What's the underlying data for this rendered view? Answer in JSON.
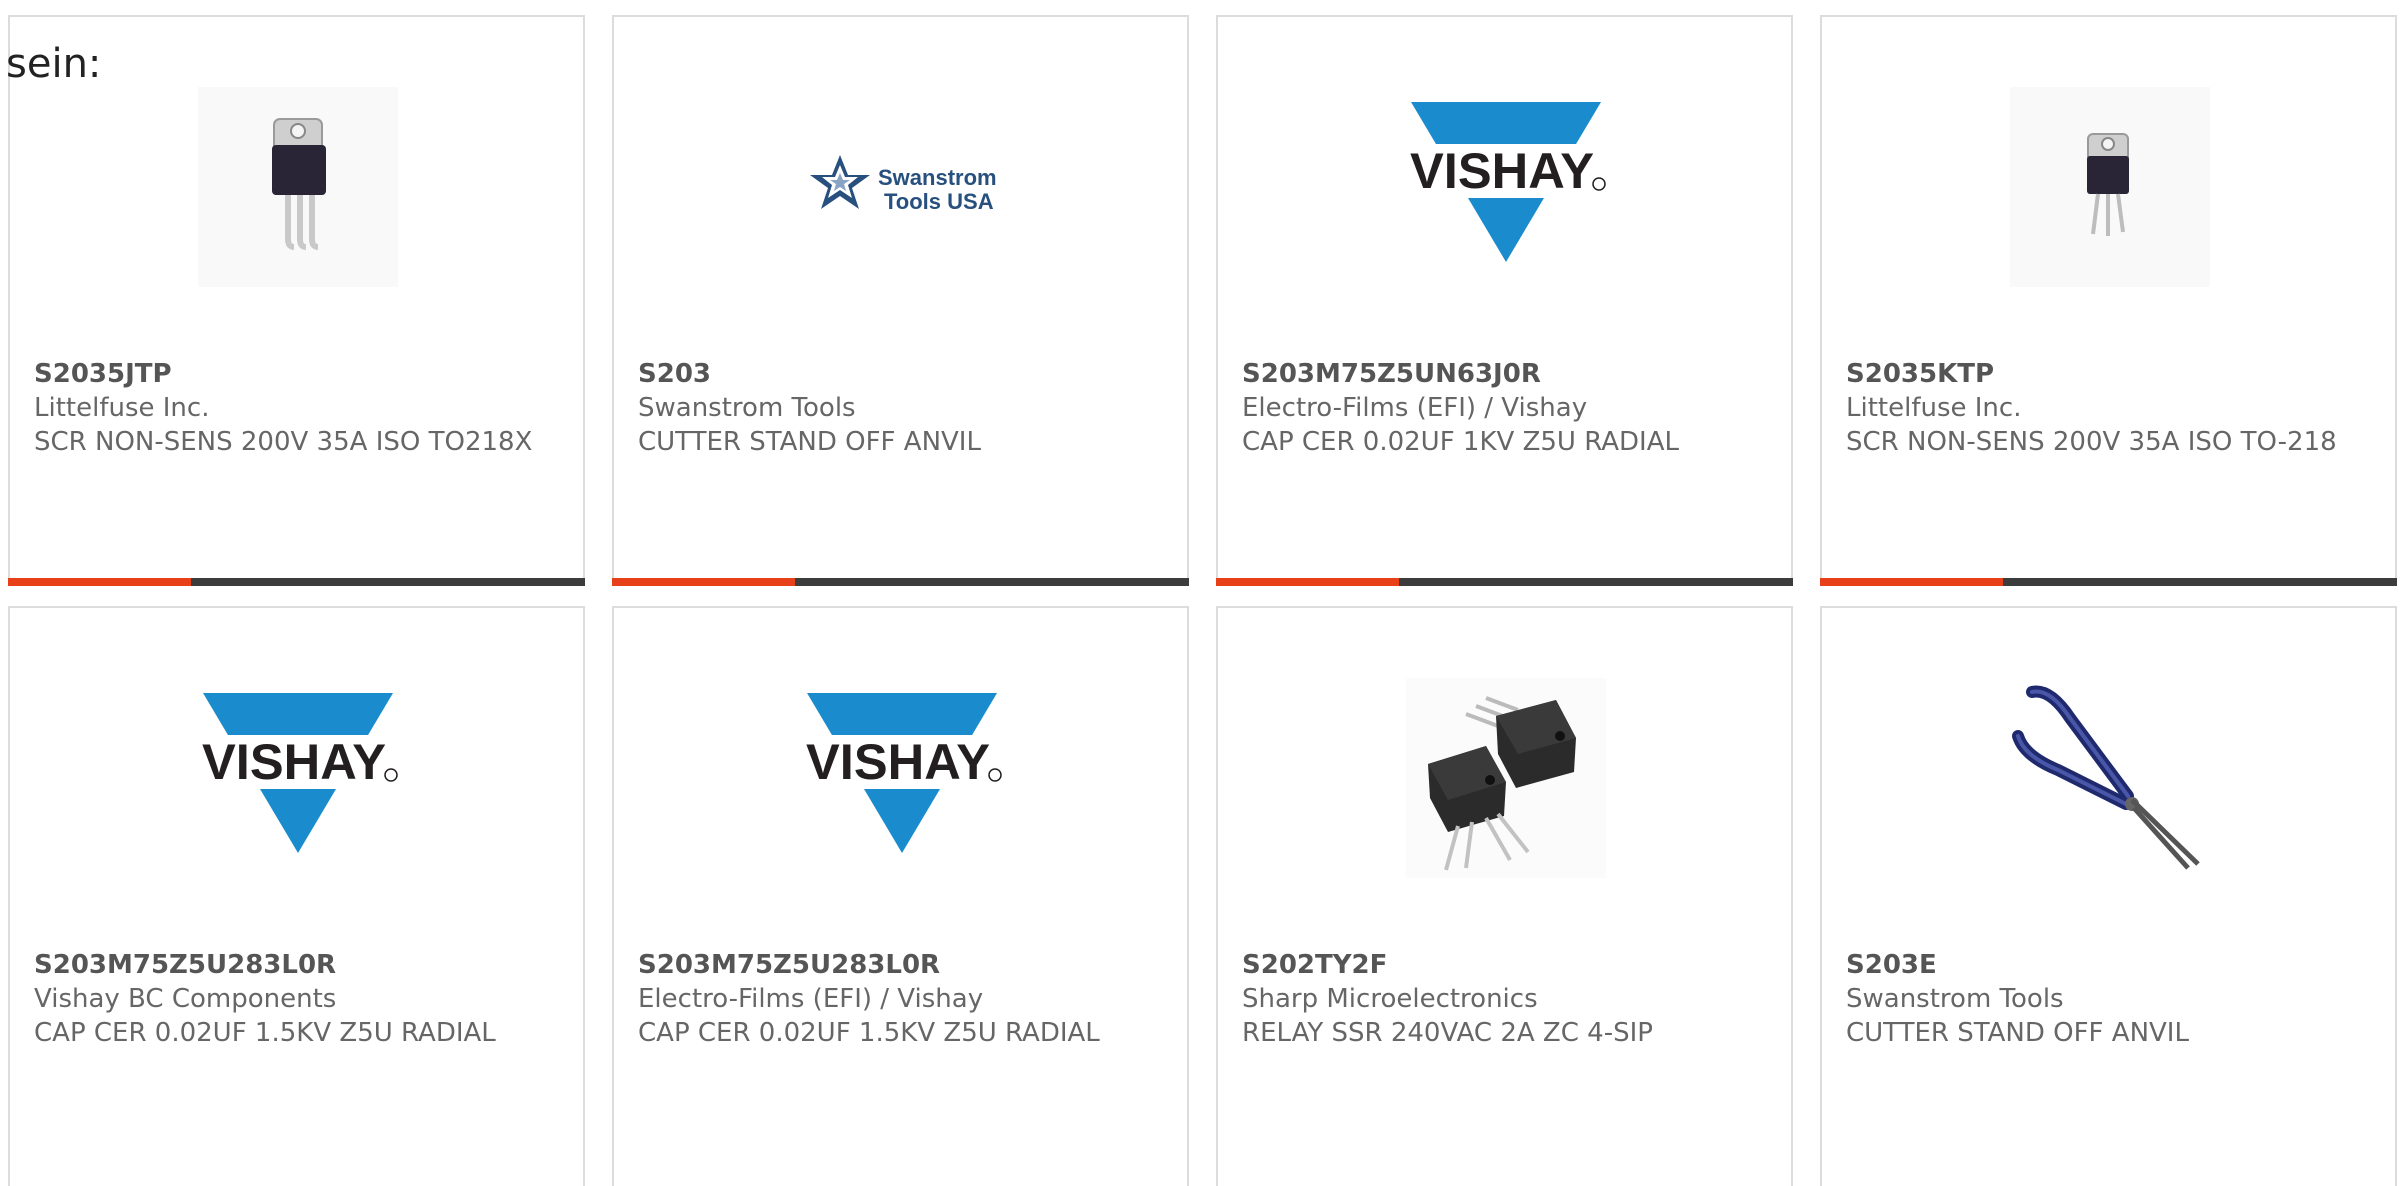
{
  "lead_text": "sein:",
  "colors": {
    "accent": "#e8411a",
    "bar": "#3c3c3c",
    "vishay_blue": "#1a8ccd",
    "border": "#dcdcdc"
  },
  "products": [
    {
      "part_number": "S2035JTP",
      "manufacturer": "Littelfuse Inc.",
      "description": "SCR NON-SENS 200V 35A ISO TO218X",
      "image": "scr-to218-component-icon"
    },
    {
      "part_number": "S203",
      "manufacturer": "Swanstrom Tools",
      "description": "CUTTER STAND OFF ANVIL",
      "image": "swanstrom-tools-logo",
      "logo_text": [
        "Swanstrom",
        "Tools USA"
      ]
    },
    {
      "part_number": "S203M75Z5UN63J0R",
      "manufacturer": "Electro-Films (EFI) / Vishay",
      "description": "CAP CER 0.02UF 1KV Z5U RADIAL",
      "image": "vishay-logo",
      "logo_text": "VISHAY"
    },
    {
      "part_number": "S2035KTP",
      "manufacturer": "Littelfuse Inc.",
      "description": "SCR NON-SENS 200V 35A ISO TO-218",
      "image": "scr-to218-component-icon"
    },
    {
      "part_number": "S203M75Z5U283L0R",
      "manufacturer": "Vishay BC Components",
      "description": "CAP CER 0.02UF 1.5KV Z5U RADIAL",
      "image": "vishay-logo",
      "logo_text": "VISHAY"
    },
    {
      "part_number": "S203M75Z5U283L0R",
      "manufacturer": "Electro-Films (EFI) / Vishay",
      "description": "CAP CER 0.02UF 1.5KV Z5U RADIAL",
      "image": "vishay-logo",
      "logo_text": "VISHAY"
    },
    {
      "part_number": "S202TY2F",
      "manufacturer": "Sharp Microelectronics",
      "description": "RELAY SSR 240VAC 2A ZC 4-SIP",
      "image": "ssr-relay-component-icon"
    },
    {
      "part_number": "S203E",
      "manufacturer": "Swanstrom Tools",
      "description": "CUTTER STAND OFF ANVIL",
      "image": "cutter-pliers-icon"
    }
  ]
}
